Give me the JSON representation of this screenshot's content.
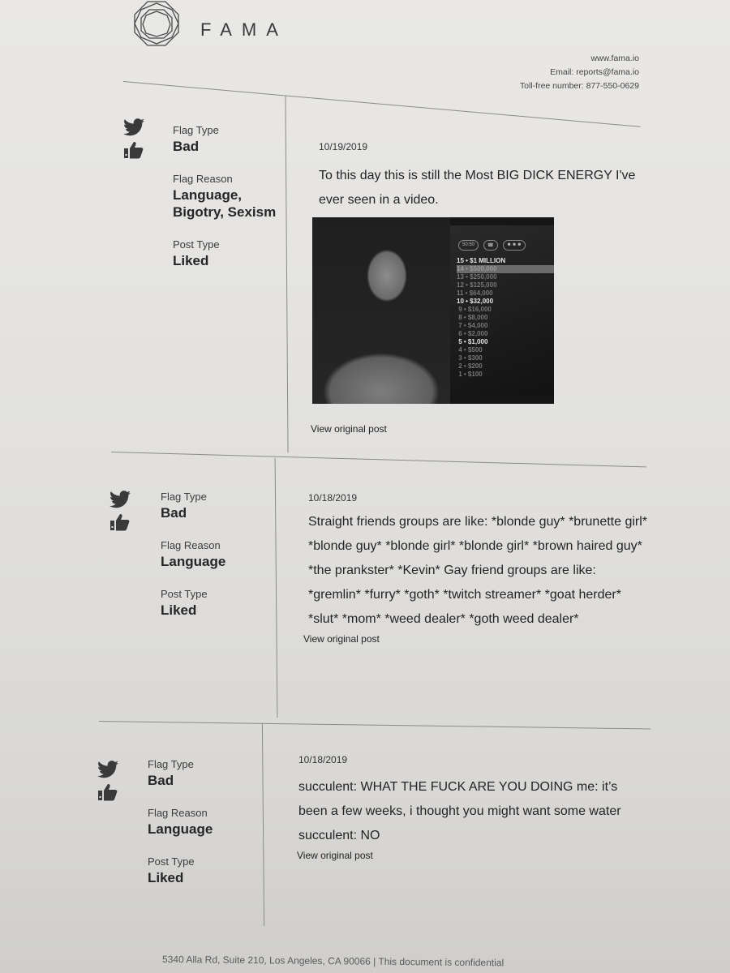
{
  "header": {
    "brand": "FAMA",
    "logo_icon": "octagon-gem-logo",
    "website": "www.fama.io",
    "email": "Email: reports@fama.io",
    "phone": "Toll-free number: 877-550-0629"
  },
  "cards": [
    {
      "platform_icon": "twitter-icon",
      "post_type_icon": "thumbs-up-icon",
      "flag_type_label": "Flag Type",
      "flag_type": "Bad",
      "flag_reason_label": "Flag Reason",
      "flag_reason": "Language, Bigotry, Sexism",
      "post_type_label": "Post Type",
      "post_type": "Liked",
      "date": "10/19/2019",
      "text": "To this day this is still the Most BIG DICK ENERGY I've ever seen in a video.",
      "media": {
        "description": "Game show contestant video still",
        "lifelines": [
          "50:50",
          "phone",
          "audience"
        ],
        "ladder": [
          {
            "level": "15",
            "amount": "$1 MILLION",
            "style": "hi"
          },
          {
            "level": "14",
            "amount": "$500,000",
            "style": "sel"
          },
          {
            "level": "13",
            "amount": "$250,000",
            "style": ""
          },
          {
            "level": "12",
            "amount": "$125,000",
            "style": ""
          },
          {
            "level": "11",
            "amount": "$64,000",
            "style": ""
          },
          {
            "level": "10",
            "amount": "$32,000",
            "style": "hi"
          },
          {
            "level": "9",
            "amount": "$16,000",
            "style": ""
          },
          {
            "level": "8",
            "amount": "$8,000",
            "style": ""
          },
          {
            "level": "7",
            "amount": "$4,000",
            "style": ""
          },
          {
            "level": "6",
            "amount": "$2,000",
            "style": ""
          },
          {
            "level": "5",
            "amount": "$1,000",
            "style": "hi"
          },
          {
            "level": "4",
            "amount": "$500",
            "style": ""
          },
          {
            "level": "3",
            "amount": "$300",
            "style": ""
          },
          {
            "level": "2",
            "amount": "$200",
            "style": ""
          },
          {
            "level": "1",
            "amount": "$100",
            "style": ""
          }
        ]
      },
      "link": "View original post"
    },
    {
      "platform_icon": "twitter-icon",
      "post_type_icon": "thumbs-up-icon",
      "flag_type_label": "Flag Type",
      "flag_type": "Bad",
      "flag_reason_label": "Flag Reason",
      "flag_reason": "Language",
      "post_type_label": "Post Type",
      "post_type": "Liked",
      "date": "10/18/2019",
      "text": "Straight friends groups are like: *blonde guy* *brunette girl* *blonde guy* *blonde girl* *blonde girl* *brown haired guy* *the prankster* *Kevin* Gay friend groups are like: *gremlin* *furry* *goth* *twitch streamer* *goat herder* *slut* *mom* *weed dealer* *goth weed dealer*",
      "link": "View original post"
    },
    {
      "platform_icon": "twitter-icon",
      "post_type_icon": "thumbs-up-icon",
      "flag_type_label": "Flag Type",
      "flag_type": "Bad",
      "flag_reason_label": "Flag Reason",
      "flag_reason": "Language",
      "post_type_label": "Post Type",
      "post_type": "Liked",
      "date": "10/18/2019",
      "text": "succulent: WHAT THE FUCK ARE YOU DOING me: it’s been a few weeks, i thought you might want some water succulent: NO",
      "link": "View original post"
    }
  ],
  "footer": {
    "text": "5340 Alla Rd, Suite 210, Los Angeles, CA 90066 | This document is confidential"
  }
}
